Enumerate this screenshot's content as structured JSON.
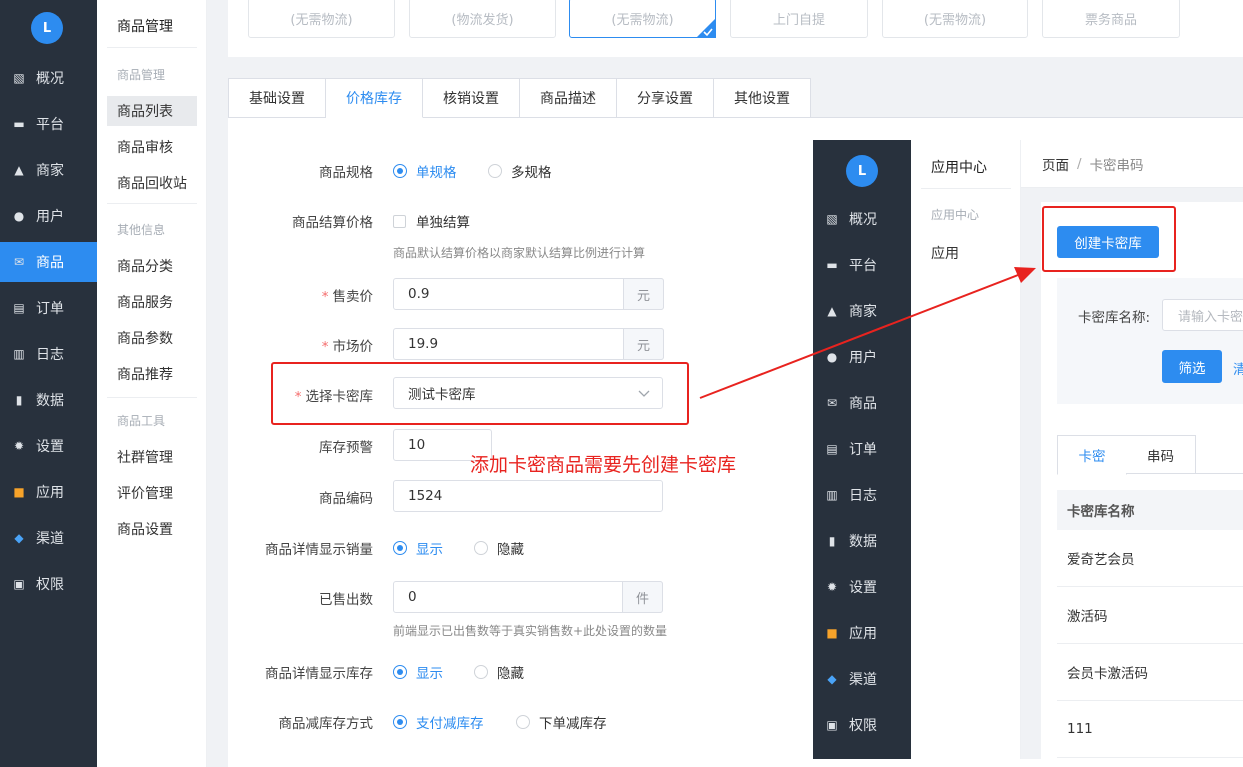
{
  "sidebar": {
    "logo": "L",
    "items": [
      {
        "label": "概况",
        "icon": "dashboard-icon"
      },
      {
        "label": "平台",
        "icon": "monitor-icon"
      },
      {
        "label": "商家",
        "icon": "store-icon"
      },
      {
        "label": "用户",
        "icon": "user-icon"
      },
      {
        "label": "商品",
        "icon": "product-icon"
      },
      {
        "label": "订单",
        "icon": "order-icon"
      },
      {
        "label": "日志",
        "icon": "log-icon"
      },
      {
        "label": "数据",
        "icon": "chart-icon"
      },
      {
        "label": "设置",
        "icon": "gear-icon"
      },
      {
        "label": "应用",
        "icon": "apps-icon"
      },
      {
        "label": "渠道",
        "icon": "cube-icon"
      },
      {
        "label": "权限",
        "icon": "lock-icon"
      }
    ]
  },
  "submenu": {
    "title": "商品管理",
    "group1": "商品管理",
    "g1_items": [
      "商品列表",
      "商品审核",
      "商品回收站"
    ],
    "group2": "其他信息",
    "g2_items": [
      "商品分类",
      "商品服务",
      "商品参数",
      "商品推荐"
    ],
    "group3": "商品工具",
    "g3_items": [
      "社群管理",
      "评价管理",
      "商品设置"
    ]
  },
  "type_boxes": [
    "(无需物流)",
    "(物流发货)",
    "(无需物流)",
    "上门自提",
    "(无需物流)",
    "票务商品"
  ],
  "tabs": [
    "基础设置",
    "价格库存",
    "核销设置",
    "商品描述",
    "分享设置",
    "其他设置"
  ],
  "form": {
    "spec_label": "商品规格",
    "spec_single": "单规格",
    "spec_multi": "多规格",
    "settle_label": "商品结算价格",
    "settle_opt": "单独结算",
    "settle_hint": "商品默认结算价格以商家默认结算比例进行计算",
    "price_label": "售卖价",
    "price_value": "0.9",
    "price_unit": "元",
    "market_label": "市场价",
    "market_value": "19.9",
    "market_unit": "元",
    "lib_label": "选择卡密库",
    "lib_value": "测试卡密库",
    "warn_label": "库存预警",
    "warn_value": "10",
    "code_label": "商品编码",
    "code_value": "1524",
    "showsales_label": "商品详情显示销量",
    "show": "显示",
    "hide": "隐藏",
    "sold_label": "已售出数",
    "sold_value": "0",
    "sold_unit": "件",
    "sold_hint": "前端显示已出售数等于真实销售数+此处设置的数量",
    "showstock_label": "商品详情显示库存",
    "reduce_label": "商品减库存方式",
    "reduce_pay": "支付减库存",
    "reduce_order": "下单减库存"
  },
  "annotation": "添加卡密商品需要先创建卡密库",
  "overlay": {
    "sub_title": "应用中心",
    "sub_group": "应用中心",
    "sub_item": "应用",
    "breadcrumb_1": "页面",
    "breadcrumb_sep": "/",
    "breadcrumb_2": "卡密串码",
    "create_btn": "创建卡密库",
    "search_label": "卡密库名称:",
    "search_placeholder": "请输入卡密",
    "filter_btn": "筛选",
    "reset_partial": "清",
    "tabs": [
      "卡密",
      "串码"
    ],
    "table_header": "卡密库名称",
    "rows": [
      "爱奇艺会员",
      "激活码",
      "会员卡激活码",
      "111"
    ]
  }
}
